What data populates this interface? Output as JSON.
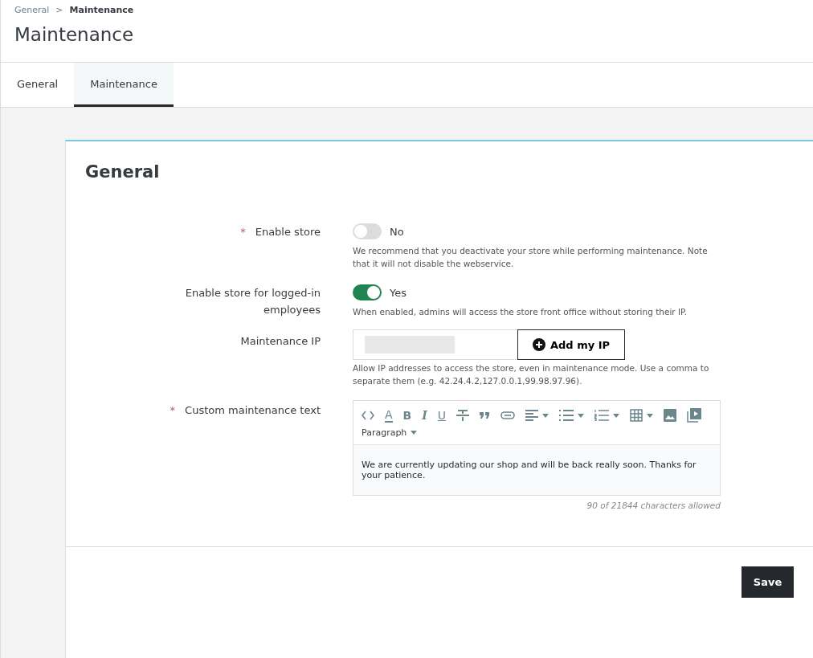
{
  "breadcrumb": [
    {
      "label": "General",
      "current": false
    },
    {
      "label": "Maintenance",
      "current": true
    }
  ],
  "breadcrumb_separator": ">",
  "title": "Maintenance",
  "tabs": [
    {
      "label": "General",
      "selected": false
    },
    {
      "label": "Maintenance",
      "selected": true
    }
  ],
  "card": {
    "title": "General",
    "fields": [
      {
        "kind": "switch",
        "label": "Enable store",
        "required_mark": "*",
        "on": false,
        "state_label": "No",
        "help": "We recommend that you deactivate your store while performing maintenance. Note that it will not disable the webservice."
      },
      {
        "kind": "switch",
        "label": "Enable store for logged-in employees",
        "on": true,
        "state_label": "Yes",
        "help": "When enabled, admins will access the store front office without storing their IP."
      },
      {
        "kind": "ip",
        "label": "Maintenance IP",
        "button": "Add my IP",
        "help": "Allow IP addresses to access the store, even in maintenance mode. Use a comma to separate them (e.g. 42.24.4.2,127.0.0.1,99.98.97.96)."
      },
      {
        "kind": "editor",
        "label": "Custom maintenance text",
        "required_mark": "*",
        "toolbar": [
          {
            "kind": "icon"
          },
          {
            "kind": "glyph",
            "label": "A"
          },
          {
            "kind": "glyph",
            "label": "B"
          },
          {
            "kind": "glyph",
            "label": "I"
          },
          {
            "kind": "glyph",
            "label": "U"
          },
          {
            "kind": "icon"
          },
          {
            "kind": "icon"
          },
          {
            "kind": "icon"
          },
          {
            "kind": "icon"
          },
          {
            "kind": "icon"
          },
          {
            "kind": "icon"
          },
          {
            "kind": "icon"
          },
          {
            "kind": "icon"
          },
          {
            "kind": "icon"
          },
          {
            "kind": "select",
            "label": "Paragraph"
          }
        ],
        "text": "We are currently updating our shop and will be back really soon. Thanks for your patience.",
        "counter": "90 of 21844 characters allowed"
      }
    ],
    "save": "Save"
  }
}
